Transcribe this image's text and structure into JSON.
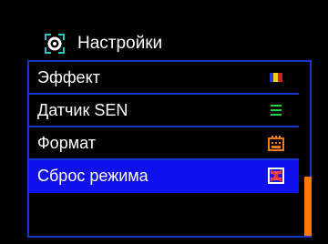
{
  "header": {
    "title": "Настройки",
    "icon": "settings-icon"
  },
  "menu": {
    "items": [
      {
        "label": "Эффект",
        "icon": "effect-icon"
      },
      {
        "label": "Датчик SEN",
        "icon": "sensor-icon"
      },
      {
        "label": "Формат",
        "icon": "format-icon"
      },
      {
        "label": "Сброс режима",
        "icon": "reset-icon",
        "selected": true
      },
      {
        "label": "",
        "icon": ""
      }
    ]
  },
  "colors": {
    "accent": "#1010ef",
    "border": "#1837c4",
    "scrollbar": "#ff7a00"
  }
}
